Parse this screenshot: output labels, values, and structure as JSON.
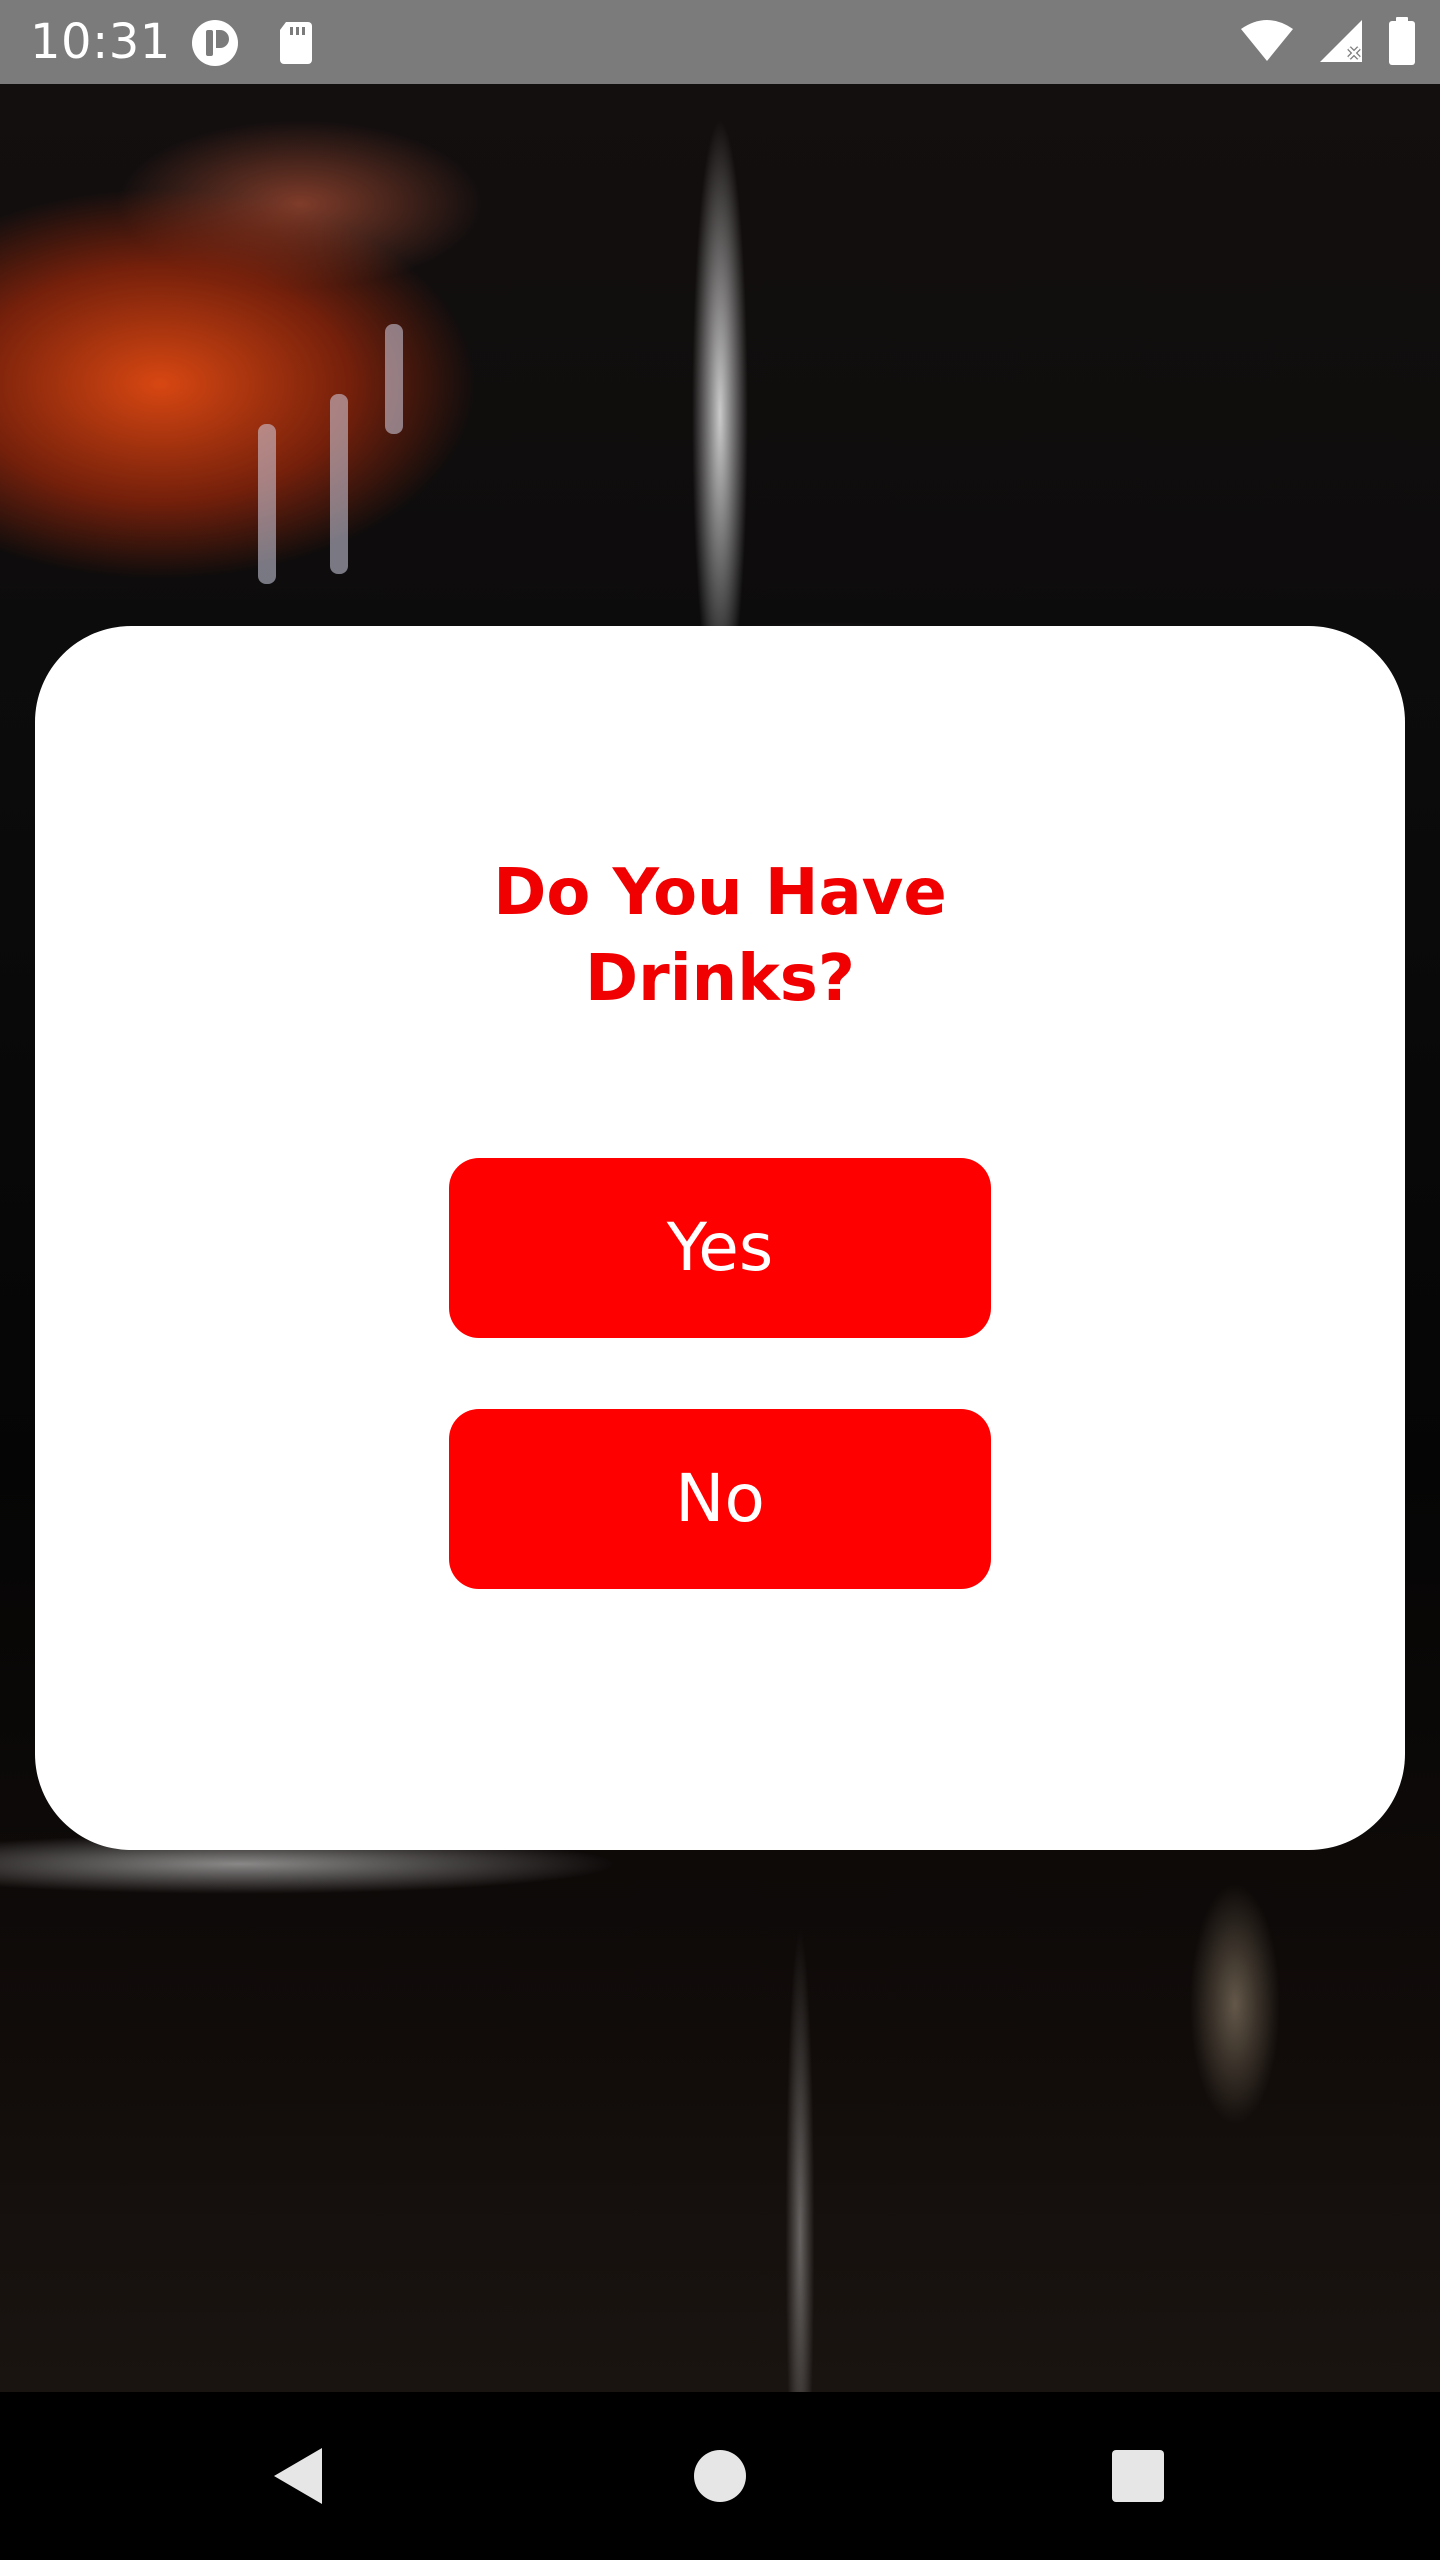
{
  "status_bar": {
    "time": "10:31",
    "icons": [
      "app-notification-icon",
      "sd-card-icon",
      "wifi-icon",
      "cellular-signal-icon",
      "battery-icon"
    ]
  },
  "dialog": {
    "title": "Do You Have\n  Drinks?",
    "yes_label": "Yes",
    "no_label": "No"
  },
  "colors": {
    "accent": "#ff0000",
    "title": "#f00000",
    "dialog_bg": "#ffffff",
    "status_bar_bg": "#7b7b7b"
  },
  "nav_bar": {
    "icons": [
      "back-icon",
      "home-icon",
      "recents-icon"
    ]
  }
}
